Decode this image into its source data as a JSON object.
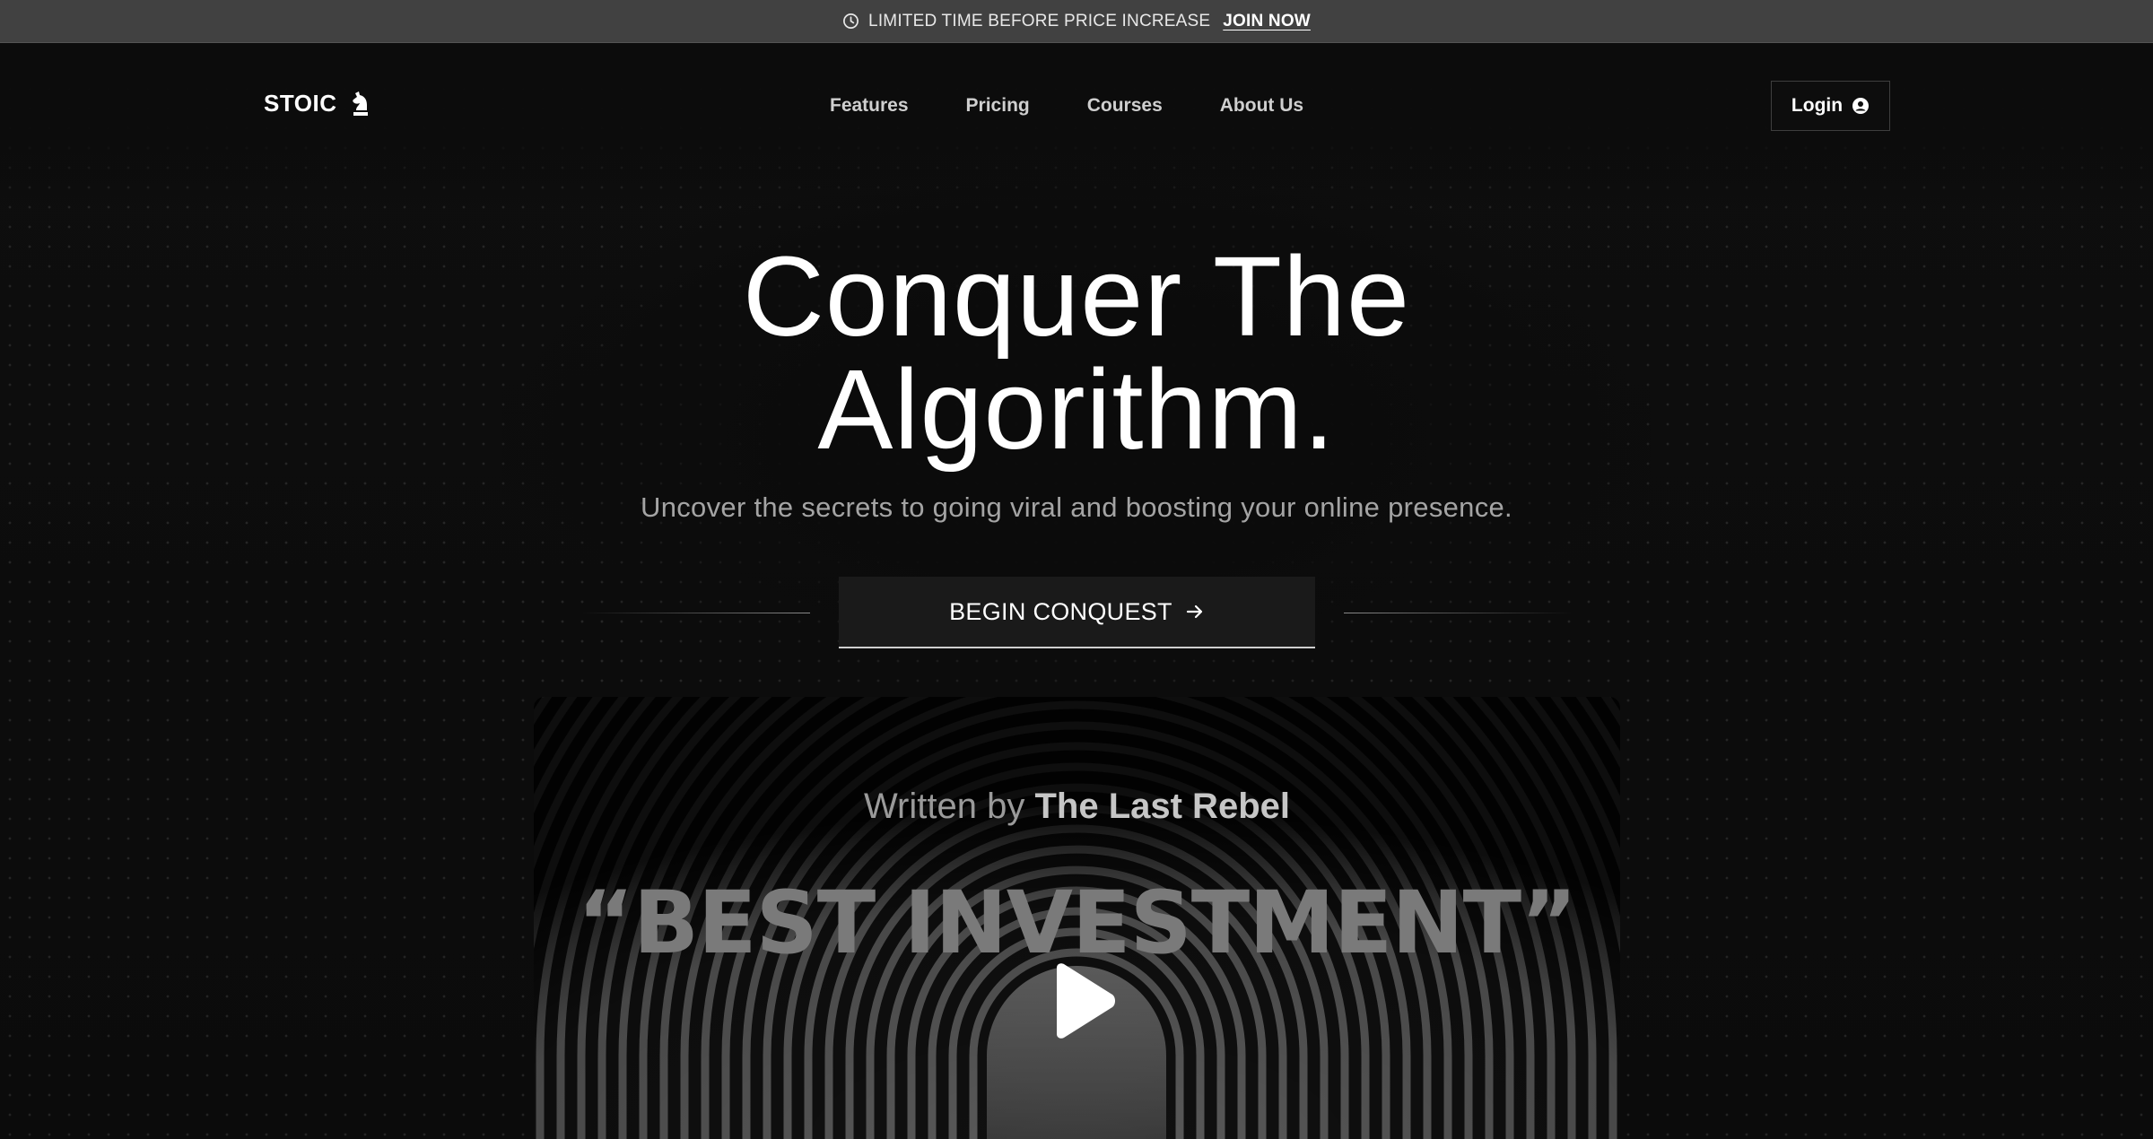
{
  "announcement": {
    "text": "LIMITED TIME BEFORE PRICE INCREASE",
    "link": "JOIN NOW",
    "icon": "clock-icon"
  },
  "nav": {
    "logo_text": "STOIC",
    "logo_icon": "chess-knight-icon",
    "links": [
      "Features",
      "Pricing",
      "Courses",
      "About Us"
    ],
    "login_label": "Login",
    "login_icon": "user-circle-icon"
  },
  "hero": {
    "title_line1": "Conquer The",
    "title_line2": "Algorithm.",
    "subtitle": "Uncover the secrets to going viral and boosting your online presence.",
    "cta_label": "BEGIN CONQUEST",
    "cta_icon": "arrow-right-icon"
  },
  "video": {
    "written_prefix": "Written by",
    "author": "The Last Rebel",
    "quote": "“BEST INVESTMENT”",
    "play_icon": "play-icon"
  },
  "colors": {
    "background": "#0b0b0b",
    "announcement_bar": "#414141",
    "accent": "#ffffff",
    "muted_text": "#a4a4a4"
  }
}
